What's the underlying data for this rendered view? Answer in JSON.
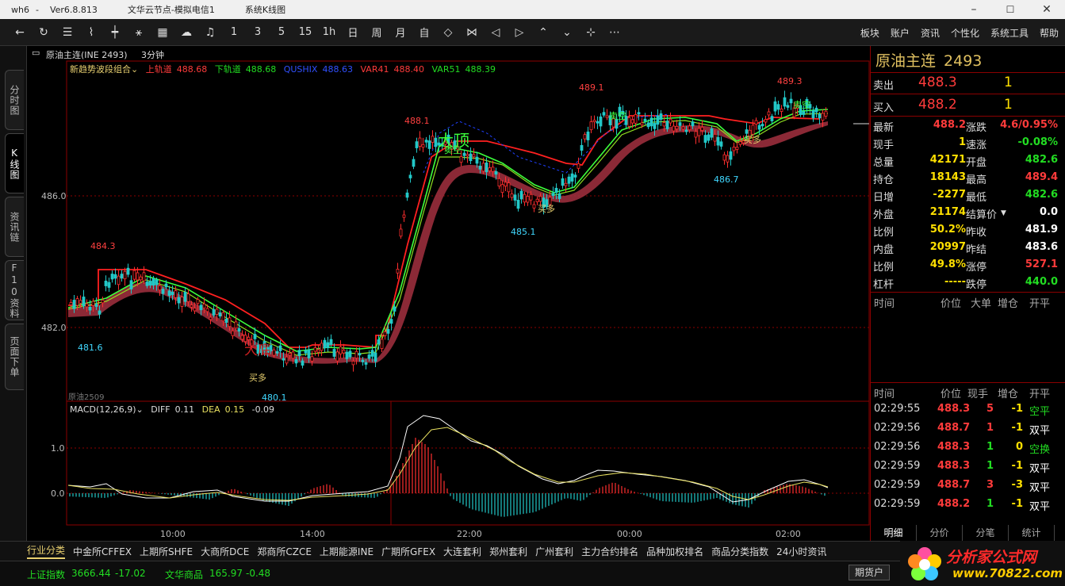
{
  "titlebar": {
    "app": "wh6",
    "version": "Ver6.8.813",
    "node": "文华云节点-模拟电信1",
    "view": "系统K线图",
    "minimize": "–",
    "maximize": "☐",
    "close": "✕"
  },
  "toolbar": {
    "periods": [
      "1",
      "3",
      "5",
      "15",
      "1h",
      "日",
      "周",
      "月",
      "自"
    ],
    "menu": [
      "板块",
      "账户",
      "资讯",
      "个性化",
      "系统工具",
      "帮助"
    ]
  },
  "left_tabs": [
    "分时图",
    "K线图",
    "资讯链",
    "F10资料",
    "页面下单"
  ],
  "chart": {
    "contract": "原油主连(INE 2493)",
    "period": "3分钟",
    "indicator_name": "新趋势波段组合",
    "upper_label": "上轨道",
    "upper_value": "488.68",
    "lower_label": "下轨道",
    "lower_value": "488.68",
    "qushi_label": "QUSHIX",
    "qushi_value": "488.63",
    "var41_label": "VAR41",
    "var41_value": "488.40",
    "var51_label": "VAR51",
    "var51_value": "488.39",
    "price_ticks": [
      "486.0",
      "482.0"
    ],
    "macd_ticks": [
      "1.0",
      "0.0"
    ],
    "time_ticks": [
      "10:00",
      "14:00",
      "22:00",
      "00:00",
      "02:00"
    ],
    "high_low_labels": [
      "484.3",
      "481.6",
      "480.1",
      "488.1",
      "485.1",
      "489.1",
      "486.7",
      "489.3"
    ],
    "signal_labels": [
      "买多",
      "买多",
      "买多",
      "卖空",
      "卖空",
      "卖空"
    ],
    "big_labels": [
      "大顶",
      "大底"
    ],
    "sub_contract": "原油2509",
    "macd_name": "MACD(12,26,9)",
    "diff_label": "DIFF",
    "diff_value": "0.11",
    "dea_label": "DEA",
    "dea_value": "0.15",
    "macd_value": "-0.09"
  },
  "quote": {
    "name": "原油主连",
    "code": "2493",
    "sell_label": "卖出",
    "sell_price": "488.3",
    "sell_qty": "1",
    "buy_label": "买入",
    "buy_price": "488.2",
    "buy_qty": "1",
    "rows": [
      {
        "l1": "最新",
        "v1": "488.2",
        "c1": "#ff3b3b",
        "l2": "涨跌",
        "v2": "4.6/0.95%",
        "c2": "#ff3b3b"
      },
      {
        "l1": "现手",
        "v1": "1",
        "c1": "#ffe000",
        "l2": "速涨",
        "v2": "-0.08%",
        "c2": "#22dd22"
      },
      {
        "l1": "总量",
        "v1": "42171",
        "c1": "#ffe000",
        "l2": "开盘",
        "v2": "482.6",
        "c2": "#22dd22"
      },
      {
        "l1": "持仓",
        "v1": "18143",
        "c1": "#ffe000",
        "l2": "最高",
        "v2": "489.4",
        "c2": "#ff3b3b"
      },
      {
        "l1": "日增",
        "v1": "-2277",
        "c1": "#ffe000",
        "l2": "最低",
        "v2": "482.6",
        "c2": "#22dd22"
      },
      {
        "l1": "外盘",
        "v1": "21174",
        "c1": "#ffe000",
        "l2": "结算价",
        "v2": "0.0",
        "c2": "#ffffff"
      },
      {
        "l1": "比例",
        "v1": "50.2%",
        "c1": "#ffe000",
        "l2": "昨收",
        "v2": "481.9",
        "c2": "#ffffff"
      },
      {
        "l1": "内盘",
        "v1": "20997",
        "c1": "#ffe000",
        "l2": "昨结",
        "v2": "483.6",
        "c2": "#ffffff"
      },
      {
        "l1": "比例",
        "v1": "49.8%",
        "c1": "#ffe000",
        "l2": "涨停",
        "v2": "527.1",
        "c2": "#ff3b3b"
      },
      {
        "l1": "杠杆",
        "v1": "-----",
        "c1": "#ffe000",
        "l2": "跌停",
        "v2": "440.0",
        "c2": "#22dd22"
      }
    ],
    "list_header": [
      "时间",
      "价位",
      "大单",
      "增仓",
      "开平"
    ],
    "tick_header": [
      "时间",
      "价位",
      "现手",
      "增仓",
      "开平"
    ],
    "ticks": [
      {
        "time": "02:29:55",
        "price": "488.3",
        "qty": "5",
        "chg": "-1",
        "type": "空平",
        "qc": "#ff3b3b",
        "tc": "#22dd22"
      },
      {
        "time": "02:29:56",
        "price": "488.7",
        "qty": "1",
        "chg": "-1",
        "type": "双平",
        "qc": "#ff3b3b",
        "tc": "#ffffff"
      },
      {
        "time": "02:29:56",
        "price": "488.3",
        "qty": "1",
        "chg": "0",
        "type": "空换",
        "qc": "#22dd22",
        "tc": "#22dd22"
      },
      {
        "time": "02:29:59",
        "price": "488.3",
        "qty": "1",
        "chg": "-1",
        "type": "双平",
        "qc": "#22dd22",
        "tc": "#ffffff"
      },
      {
        "time": "02:29:59",
        "price": "488.7",
        "qty": "3",
        "chg": "-3",
        "type": "双平",
        "qc": "#ff3b3b",
        "tc": "#ffffff"
      },
      {
        "time": "02:29:59",
        "price": "488.2",
        "qty": "1",
        "chg": "-1",
        "type": "双平",
        "qc": "#22dd22",
        "tc": "#ffffff"
      }
    ],
    "bottom_tabs": [
      "明细",
      "分价",
      "分笔",
      "统计"
    ]
  },
  "category_bar": [
    "行业分类",
    "中金所CFFEX",
    "上期所SHFE",
    "大商所DCE",
    "郑商所CZCE",
    "上期能源INE",
    "广期所GFEX",
    "大连套利",
    "郑州套利",
    "广州套利",
    "主力合约排名",
    "品种加权排名",
    "商品分类指数",
    "24小时资讯"
  ],
  "status": {
    "idx1_name": "上证指数",
    "idx1_value": "3666.44",
    "idx1_change": "-17.02",
    "idx2_name": "文华商品",
    "idx2_value": "165.97",
    "idx2_change": "-0.48",
    "futures_button": "期货户"
  },
  "logo": {
    "title": "分析家公式网",
    "url": "www.70822.com"
  },
  "colors": {
    "up": "#ff3b3b",
    "down": "#22dd22",
    "grid": "#8b0000",
    "bar_up": "#ff2e2e",
    "bar_down": "#22c8c8"
  },
  "chart_data": {
    "type": "candlestick",
    "price_range": [
      480.0,
      490.0
    ],
    "start_price": 482.6,
    "highs_marked": [
      484.3,
      488.1,
      489.1,
      489.3
    ],
    "lows_marked": [
      481.6,
      480.1,
      485.1,
      486.7
    ],
    "last_price": 488.2,
    "macd": {
      "diff": 0.11,
      "dea": 0.15,
      "macd": -0.09
    }
  }
}
